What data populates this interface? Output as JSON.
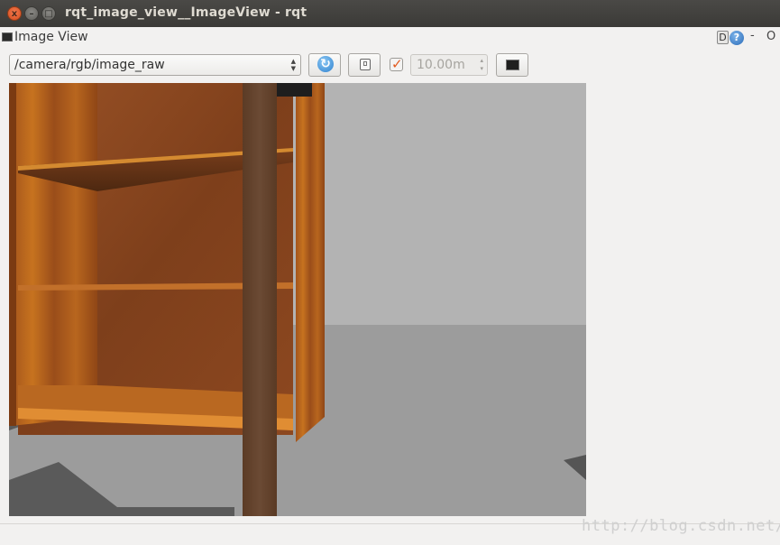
{
  "window": {
    "title": "rqt_image_view__ImageView - rqt",
    "close_glyph": "x",
    "min_glyph": "–",
    "max_glyph": "□"
  },
  "dock": {
    "title": "Image View",
    "icon": "image-view-icon",
    "d_label": "D",
    "help_label": "?",
    "minimize_label": "-",
    "close_label": "O"
  },
  "toolbar": {
    "topic": "/camera/rgb/image_raw",
    "refresh_icon": "refresh-icon",
    "save_icon": "save-icon",
    "smooth_checked": true,
    "max_range": "10.00m",
    "color_icon": "color-scheme-icon"
  },
  "colors": {
    "accent_check": "#e25a1e",
    "refresh_blue": "#2f82cf",
    "titlebar": "#3f3e3a"
  },
  "watermark": "http://blog.csdn.net/"
}
